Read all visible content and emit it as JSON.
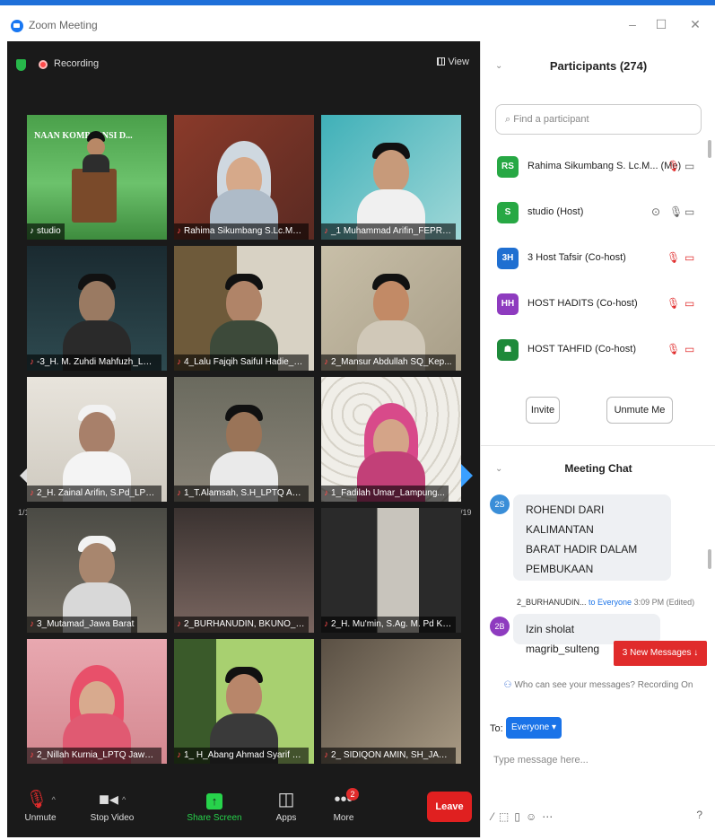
{
  "window": {
    "title": "Zoom Meeting",
    "controls": [
      "–",
      "☐",
      "✕"
    ]
  },
  "video": {
    "recording_label": "Recording",
    "view_label": "View",
    "page_left": "1/19",
    "page_right": "1/19",
    "tiles": [
      {
        "name": "studio",
        "active": true
      },
      {
        "name": "Rahima Sikumbang S.Lc.MA..."
      },
      {
        "name": "_1 Muhammad Arifin_FEPRI..."
      },
      {
        "name": "-3_H. M. Zuhdi Mahfuzh_LPT..."
      },
      {
        "name": "4_Lalu Fajqih Saiful Hadie_LP..."
      },
      {
        "name": "2_Mansur Abdullah SQ_Kep..."
      },
      {
        "name": "2_H. Zainal Arifin, S.Pd_LPTQ..."
      },
      {
        "name": "1_T.Alamsah, S.H_LPTQ Aceh"
      },
      {
        "name": "1_Fadilah Umar_Lampung..."
      },
      {
        "name": "3_Mutamad_Jawa Barat"
      },
      {
        "name": "2_BURHANUDIN, BKUNO_S..."
      },
      {
        "name": "2_H. Mu'min, S.Ag. M. Pd Ka..."
      },
      {
        "name": "2_Nillah Kurnia_LPTQ Jawa ..."
      },
      {
        "name": "1_ H_Abang Ahmad Syarif S..."
      },
      {
        "name": "2_ SIDIQON AMIN, SH_JAW..."
      }
    ]
  },
  "toolbar": {
    "unmute": "Unmute",
    "stop_video": "Stop Video",
    "share_screen": "Share Screen",
    "apps": "Apps",
    "more": "More",
    "more_badge": "2",
    "leave": "Leave"
  },
  "participants": {
    "title": "Participants (274)",
    "search_placeholder": "Find a participant",
    "items": [
      {
        "initials": "RS",
        "color": "#27a844",
        "name": "Rahima Sikumbang S. Lc.M...  (Me)"
      },
      {
        "initials": "S",
        "color": "#27a844",
        "name": "studio (Host)"
      },
      {
        "initials": "3H",
        "color": "#1f6fd1",
        "name": "3 Host Tafsir (Co-host)"
      },
      {
        "initials": "HH",
        "color": "#8e3bbf",
        "name": "HOST HADITS (Co-host)"
      },
      {
        "initials": "",
        "color": "#1e8a3a",
        "name": "HOST TAHFID (Co-host)"
      }
    ],
    "invite": "Invite",
    "unmute_me": "Unmute Me"
  },
  "chat": {
    "title": "Meeting Chat",
    "messages": [
      {
        "initials": "2S",
        "color": "#3a8ed8",
        "text_lines": [
          "ROHENDI DARI KALIMANTAN",
          "BARAT HADIR DALAM",
          "PEMBUKAAN"
        ]
      },
      {
        "initials": "2B",
        "color": "#8e3bbf",
        "sender": "2_BURHANUDIN...",
        "to": "to Everyone",
        "time": "3:09 PM (Edited)",
        "text": "Izin sholat magrib_sulteng"
      }
    ],
    "new_messages": "3 New Messages ↓",
    "who_can_see": "Who can see your messages? Recording On",
    "to_label": "To:",
    "recipient": "Everyone ▾",
    "input_placeholder": "Type message here..."
  }
}
